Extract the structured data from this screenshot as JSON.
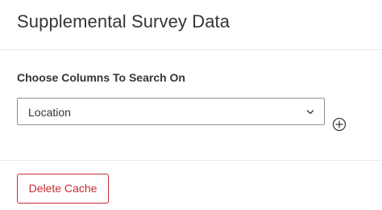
{
  "header": {
    "title": "Supplemental Survey Data"
  },
  "search_columns": {
    "label": "Choose Columns To Search On",
    "selected_value": "Location",
    "dropdown_icon": "chevron-down-icon",
    "add_icon": "plus-circle-icon"
  },
  "footer": {
    "delete_cache_label": "Delete Cache"
  },
  "colors": {
    "text": "#32363a",
    "border": "#8c8f93",
    "divider": "#e8e8e8",
    "danger": "#c92a32"
  }
}
